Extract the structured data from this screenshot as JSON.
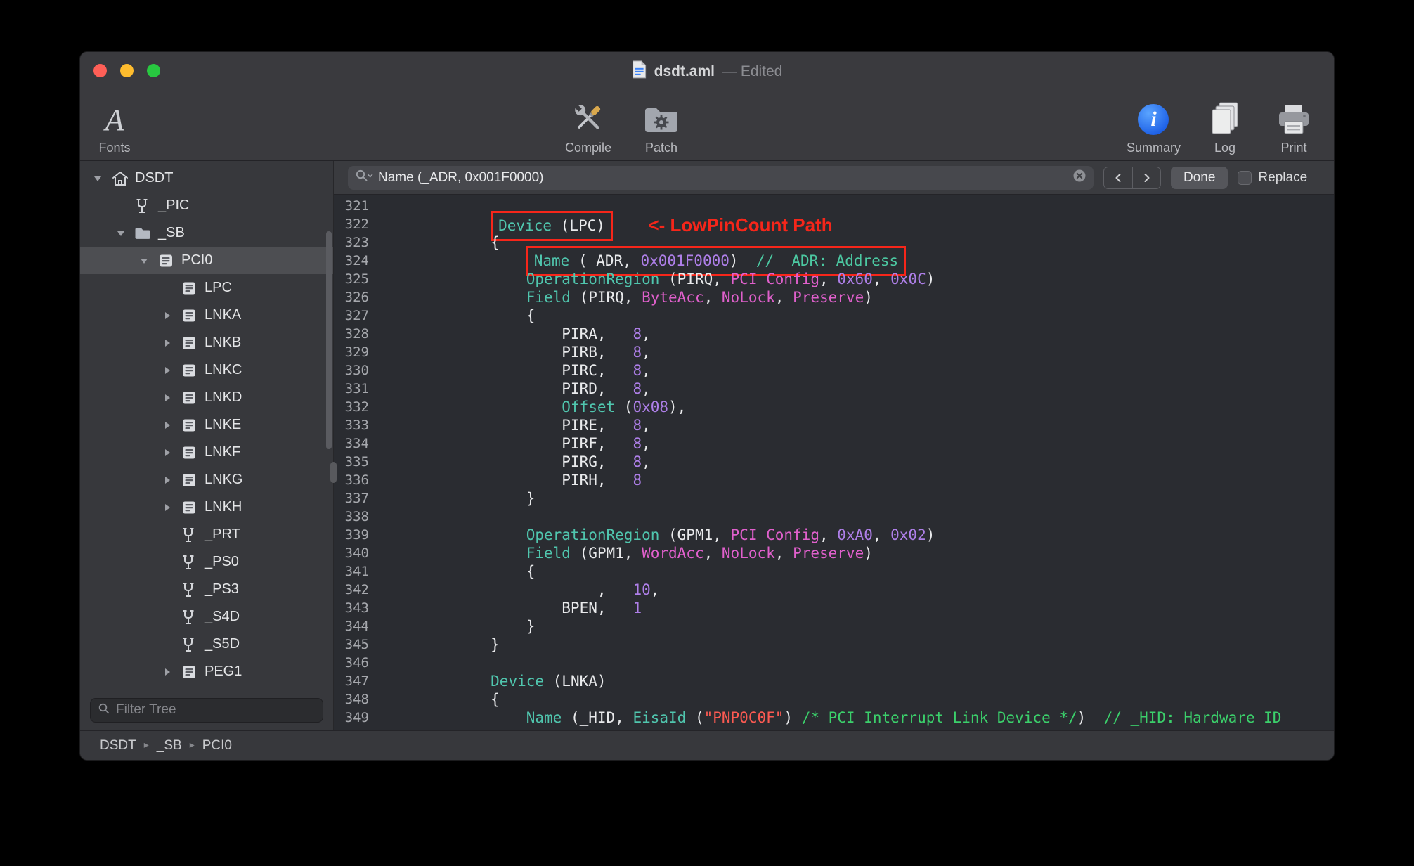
{
  "window": {
    "title_doc": "dsdt.aml",
    "title_suffix": "— Edited"
  },
  "toolbar": {
    "fonts_label": "Fonts",
    "compile_label": "Compile",
    "patch_label": "Patch",
    "summary_label": "Summary",
    "log_label": "Log",
    "print_label": "Print"
  },
  "find_bar": {
    "query": "Name (_ADR, 0x001F0000)",
    "done_label": "Done",
    "replace_label": "Replace"
  },
  "sidebar": {
    "filter_placeholder": "Filter Tree",
    "tree": [
      {
        "label": "DSDT",
        "level": 0,
        "icon": "house",
        "disclosure": "open"
      },
      {
        "label": "_PIC",
        "level": 1,
        "icon": "method",
        "disclosure": "none"
      },
      {
        "label": "_SB",
        "level": 1,
        "icon": "folder",
        "disclosure": "open"
      },
      {
        "label": "PCI0",
        "level": 2,
        "icon": "device",
        "disclosure": "open",
        "selected": true
      },
      {
        "label": "LPC",
        "level": 3,
        "icon": "device",
        "disclosure": "none"
      },
      {
        "label": "LNKA",
        "level": 3,
        "icon": "device",
        "disclosure": "closed"
      },
      {
        "label": "LNKB",
        "level": 3,
        "icon": "device",
        "disclosure": "closed"
      },
      {
        "label": "LNKC",
        "level": 3,
        "icon": "device",
        "disclosure": "closed"
      },
      {
        "label": "LNKD",
        "level": 3,
        "icon": "device",
        "disclosure": "closed"
      },
      {
        "label": "LNKE",
        "level": 3,
        "icon": "device",
        "disclosure": "closed"
      },
      {
        "label": "LNKF",
        "level": 3,
        "icon": "device",
        "disclosure": "closed"
      },
      {
        "label": "LNKG",
        "level": 3,
        "icon": "device",
        "disclosure": "closed"
      },
      {
        "label": "LNKH",
        "level": 3,
        "icon": "device",
        "disclosure": "closed"
      },
      {
        "label": "_PRT",
        "level": 3,
        "icon": "method",
        "disclosure": "none"
      },
      {
        "label": "_PS0",
        "level": 3,
        "icon": "method",
        "disclosure": "none"
      },
      {
        "label": "_PS3",
        "level": 3,
        "icon": "method",
        "disclosure": "none"
      },
      {
        "label": "_S4D",
        "level": 3,
        "icon": "method",
        "disclosure": "none"
      },
      {
        "label": "_S5D",
        "level": 3,
        "icon": "method",
        "disclosure": "none"
      },
      {
        "label": "PEG1",
        "level": 3,
        "icon": "device",
        "disclosure": "closed"
      }
    ]
  },
  "breadcrumb": [
    "DSDT",
    "_SB",
    "PCI0"
  ],
  "annotation": {
    "lpc_note": "<- LowPinCount Path",
    "red": "#f6261a"
  },
  "colors": {
    "traffic_red": "#ff5f57",
    "traffic_yellow": "#febc2e",
    "traffic_green": "#28c840",
    "syntax_keyword": "#50c6ae",
    "syntax_plain": "#e9eaec",
    "syntax_number": "#ae7fe8",
    "syntax_predefined": "#e060cc",
    "syntax_string": "#fb5a52",
    "syntax_comment": "#3bd06b",
    "editor_bg": "#2a2c31",
    "chrome_bg": "#3a3a3e"
  },
  "editor": {
    "first_line": 321,
    "lines": [
      {
        "n": 321,
        "parts": []
      },
      {
        "n": 322,
        "parts": [
          {
            "c": "p",
            "t": "        "
          },
          {
            "b": [
              {
                "c": "k",
                "t": "Device"
              },
              {
                "c": "p",
                "t": " (LPC)"
              }
            ]
          },
          {
            "c": "p",
            "t": "    "
          },
          {
            "c": "a",
            "t": "<- LowPinCount Path"
          }
        ]
      },
      {
        "n": 323,
        "parts": [
          {
            "c": "p",
            "t": "        {"
          }
        ]
      },
      {
        "n": 324,
        "parts": [
          {
            "c": "p",
            "t": "            "
          },
          {
            "b": [
              {
                "c": "k",
                "t": "Name"
              },
              {
                "c": "p",
                "t": " (_ADR, "
              },
              {
                "c": "n",
                "t": "0x001F0000"
              },
              {
                "c": "p",
                "t": ")  "
              },
              {
                "c": "c2",
                "t": "// _ADR: Address"
              }
            ]
          }
        ]
      },
      {
        "n": 325,
        "parts": [
          {
            "c": "p",
            "t": "            "
          },
          {
            "c": "k",
            "t": "OperationRegion"
          },
          {
            "c": "p",
            "t": " (PIRQ, "
          },
          {
            "c": "r",
            "t": "PCI_Config"
          },
          {
            "c": "p",
            "t": ", "
          },
          {
            "c": "n",
            "t": "0x60"
          },
          {
            "c": "p",
            "t": ", "
          },
          {
            "c": "n",
            "t": "0x0C"
          },
          {
            "c": "p",
            "t": ")"
          }
        ]
      },
      {
        "n": 326,
        "parts": [
          {
            "c": "p",
            "t": "            "
          },
          {
            "c": "k",
            "t": "Field"
          },
          {
            "c": "p",
            "t": " (PIRQ, "
          },
          {
            "c": "r",
            "t": "ByteAcc"
          },
          {
            "c": "p",
            "t": ", "
          },
          {
            "c": "r",
            "t": "NoLock"
          },
          {
            "c": "p",
            "t": ", "
          },
          {
            "c": "r",
            "t": "Preserve"
          },
          {
            "c": "p",
            "t": ")"
          }
        ]
      },
      {
        "n": 327,
        "parts": [
          {
            "c": "p",
            "t": "            {"
          }
        ]
      },
      {
        "n": 328,
        "parts": [
          {
            "c": "p",
            "t": "                PIRA,   "
          },
          {
            "c": "n",
            "t": "8"
          },
          {
            "c": "p",
            "t": ","
          }
        ]
      },
      {
        "n": 329,
        "parts": [
          {
            "c": "p",
            "t": "                PIRB,   "
          },
          {
            "c": "n",
            "t": "8"
          },
          {
            "c": "p",
            "t": ","
          }
        ]
      },
      {
        "n": 330,
        "parts": [
          {
            "c": "p",
            "t": "                PIRC,   "
          },
          {
            "c": "n",
            "t": "8"
          },
          {
            "c": "p",
            "t": ","
          }
        ]
      },
      {
        "n": 331,
        "parts": [
          {
            "c": "p",
            "t": "                PIRD,   "
          },
          {
            "c": "n",
            "t": "8"
          },
          {
            "c": "p",
            "t": ","
          }
        ]
      },
      {
        "n": 332,
        "parts": [
          {
            "c": "p",
            "t": "                "
          },
          {
            "c": "k",
            "t": "Offset"
          },
          {
            "c": "p",
            "t": " ("
          },
          {
            "c": "n",
            "t": "0x08"
          },
          {
            "c": "p",
            "t": "),"
          }
        ]
      },
      {
        "n": 333,
        "parts": [
          {
            "c": "p",
            "t": "                PIRE,   "
          },
          {
            "c": "n",
            "t": "8"
          },
          {
            "c": "p",
            "t": ","
          }
        ]
      },
      {
        "n": 334,
        "parts": [
          {
            "c": "p",
            "t": "                PIRF,   "
          },
          {
            "c": "n",
            "t": "8"
          },
          {
            "c": "p",
            "t": ","
          }
        ]
      },
      {
        "n": 335,
        "parts": [
          {
            "c": "p",
            "t": "                PIRG,   "
          },
          {
            "c": "n",
            "t": "8"
          },
          {
            "c": "p",
            "t": ","
          }
        ]
      },
      {
        "n": 336,
        "parts": [
          {
            "c": "p",
            "t": "                PIRH,   "
          },
          {
            "c": "n",
            "t": "8"
          }
        ]
      },
      {
        "n": 337,
        "parts": [
          {
            "c": "p",
            "t": "            }"
          }
        ]
      },
      {
        "n": 338,
        "parts": []
      },
      {
        "n": 339,
        "parts": [
          {
            "c": "p",
            "t": "            "
          },
          {
            "c": "k",
            "t": "OperationRegion"
          },
          {
            "c": "p",
            "t": " (GPM1, "
          },
          {
            "c": "r",
            "t": "PCI_Config"
          },
          {
            "c": "p",
            "t": ", "
          },
          {
            "c": "n",
            "t": "0xA0"
          },
          {
            "c": "p",
            "t": ", "
          },
          {
            "c": "n",
            "t": "0x02"
          },
          {
            "c": "p",
            "t": ")"
          }
        ]
      },
      {
        "n": 340,
        "parts": [
          {
            "c": "p",
            "t": "            "
          },
          {
            "c": "k",
            "t": "Field"
          },
          {
            "c": "p",
            "t": " (GPM1, "
          },
          {
            "c": "r",
            "t": "WordAcc"
          },
          {
            "c": "p",
            "t": ", "
          },
          {
            "c": "r",
            "t": "NoLock"
          },
          {
            "c": "p",
            "t": ", "
          },
          {
            "c": "r",
            "t": "Preserve"
          },
          {
            "c": "p",
            "t": ")"
          }
        ]
      },
      {
        "n": 341,
        "parts": [
          {
            "c": "p",
            "t": "            {"
          }
        ]
      },
      {
        "n": 342,
        "parts": [
          {
            "c": "p",
            "t": "                    ,   "
          },
          {
            "c": "n",
            "t": "10"
          },
          {
            "c": "p",
            "t": ","
          }
        ]
      },
      {
        "n": 343,
        "parts": [
          {
            "c": "p",
            "t": "                BPEN,   "
          },
          {
            "c": "n",
            "t": "1"
          }
        ]
      },
      {
        "n": 344,
        "parts": [
          {
            "c": "p",
            "t": "            }"
          }
        ]
      },
      {
        "n": 345,
        "parts": [
          {
            "c": "p",
            "t": "        }"
          }
        ]
      },
      {
        "n": 346,
        "parts": []
      },
      {
        "n": 347,
        "parts": [
          {
            "c": "p",
            "t": "        "
          },
          {
            "c": "k",
            "t": "Device"
          },
          {
            "c": "p",
            "t": " (LNKA)"
          }
        ]
      },
      {
        "n": 348,
        "parts": [
          {
            "c": "p",
            "t": "        {"
          }
        ]
      },
      {
        "n": 349,
        "parts": [
          {
            "c": "p",
            "t": "            "
          },
          {
            "c": "k",
            "t": "Name"
          },
          {
            "c": "p",
            "t": " (_HID, "
          },
          {
            "c": "k",
            "t": "EisaId"
          },
          {
            "c": "p",
            "t": " ("
          },
          {
            "c": "s",
            "t": "\"PNP0C0F\""
          },
          {
            "c": "p",
            "t": ") "
          },
          {
            "c": "c",
            "t": "/* PCI Interrupt Link Device */"
          },
          {
            "c": "p",
            "t": ")  "
          },
          {
            "c": "c",
            "t": "// _HID: Hardware ID"
          }
        ]
      }
    ]
  }
}
